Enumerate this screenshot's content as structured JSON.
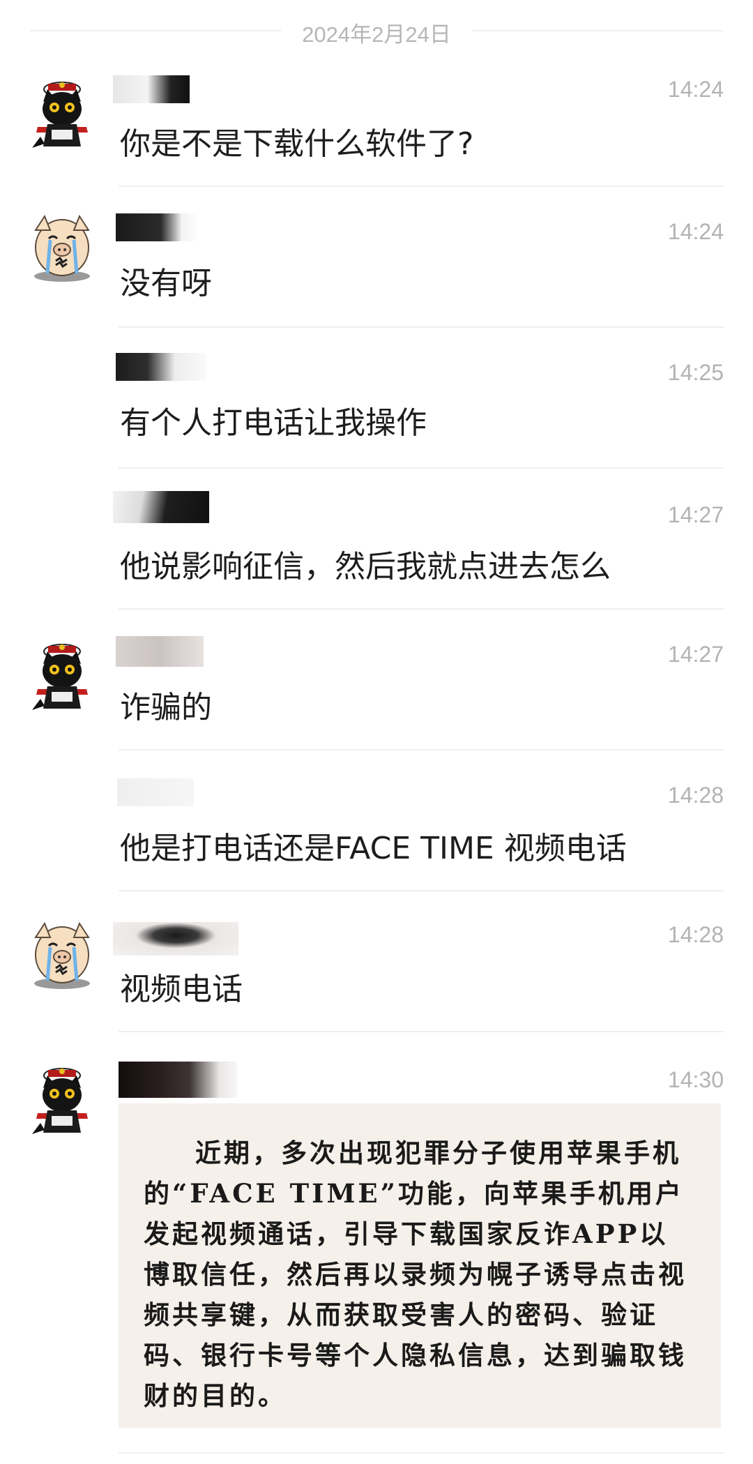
{
  "date_separator": "2024年2月24日",
  "avatars": {
    "cat": "black-cat-sheriff-avatar",
    "pig": "crying-pig-avatar"
  },
  "messages": [
    {
      "avatar": "cat",
      "time": "14:24",
      "text": "你是不是下载什么软件了?"
    },
    {
      "avatar": "pig",
      "time": "14:24",
      "text": "没有呀"
    },
    {
      "avatar": "none",
      "time": "14:25",
      "text": "有个人打电话让我操作"
    },
    {
      "avatar": "none",
      "time": "14:27",
      "text": "他说影响征信，然后我就点进去怎么"
    },
    {
      "avatar": "cat",
      "time": "14:27",
      "text": "诈骗的"
    },
    {
      "avatar": "none",
      "time": "14:28",
      "text": "他是打电话还是FACE TIME 视频电话"
    },
    {
      "avatar": "pig",
      "time": "14:28",
      "text": "视频电话"
    },
    {
      "avatar": "cat",
      "time": "14:30",
      "text": ""
    }
  ],
  "notice": {
    "text": "近期，多次出现犯罪分子使用苹果手机的“FACE TIME”功能，向苹果手机用户发起视频通话，引导下载国家反诈APP以博取信任，然后再以录频为幌子诱导点击视频共享键，从而获取受害人的密码、验证码、银行卡号等个人隐私信息，达到骗取钱财的目的。"
  }
}
